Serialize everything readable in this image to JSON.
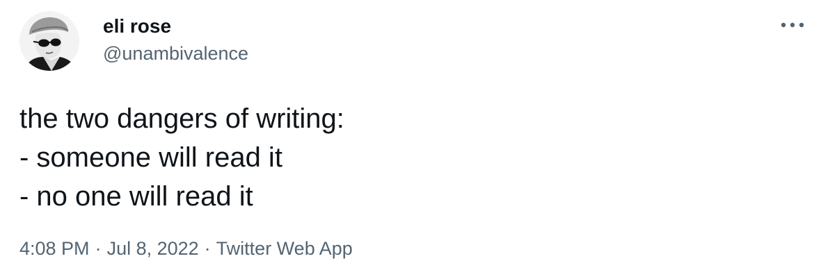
{
  "author": {
    "display_name": "eli rose",
    "handle": "@unambivalence",
    "avatar_icon": "profile-photo-sunglasses"
  },
  "actions": {
    "more_icon": "more-horizontal-icon"
  },
  "tweet": {
    "lines": [
      "the two dangers of writing:",
      "- someone will read it",
      "- no one will read it"
    ]
  },
  "meta": {
    "time": "4:08 PM",
    "separator": "·",
    "date": "Jul 8, 2022",
    "source": "Twitter Web App"
  },
  "colors": {
    "text": "#0f1419",
    "secondary": "#536471"
  }
}
